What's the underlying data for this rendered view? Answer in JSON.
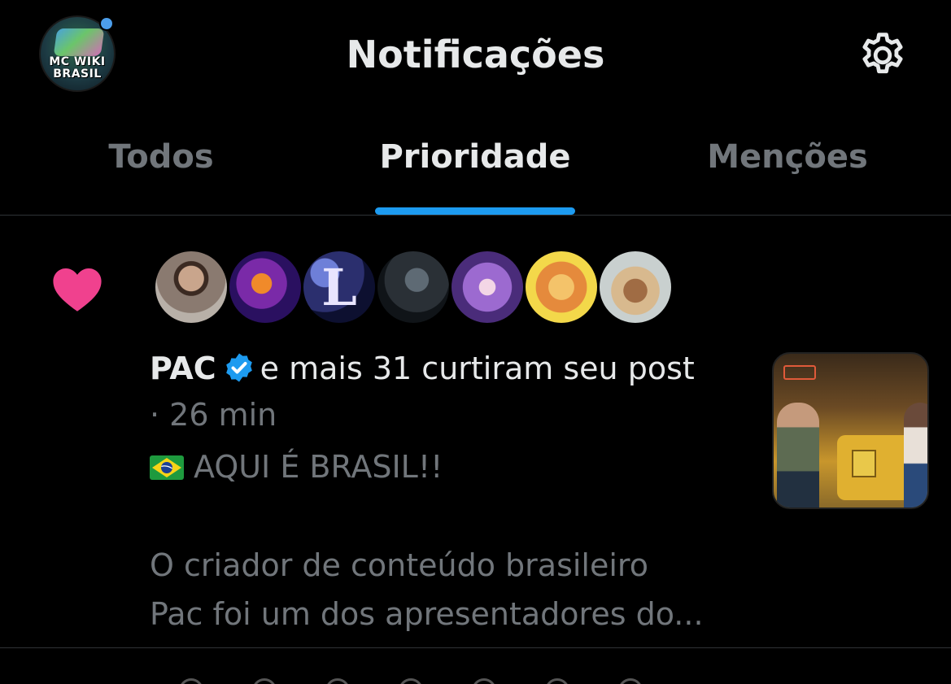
{
  "header": {
    "title": "Notificações",
    "profile_logo_text_line1": "MC WIKI",
    "profile_logo_text_line2": "BRASIL",
    "icons": {
      "settings": "gear-icon",
      "notification_dot": "blue-dot"
    }
  },
  "tabs": [
    {
      "label": "Todos",
      "active": false
    },
    {
      "label": "Prioridade",
      "active": true
    },
    {
      "label": "Menções",
      "active": false
    }
  ],
  "colors": {
    "background": "#000000",
    "accent": "#1d9bf0",
    "like": "#f0418e",
    "text_primary": "#e7e9ea",
    "text_secondary": "#71767b"
  },
  "notification": {
    "type": "like",
    "icon": "heart-icon",
    "actor_name": "PAC",
    "verified": true,
    "action_text": "e mais 31 curtiram seu post",
    "timestamp": "· 26 min",
    "post_flag": "brazil-flag-icon",
    "post_line1": "AQUI É BRASIL!!",
    "post_line2": "O criador de conteúdo brasileiro",
    "post_line3": "Pac foi um dos apresentadores do...",
    "liker_avatar_count": 7
  }
}
